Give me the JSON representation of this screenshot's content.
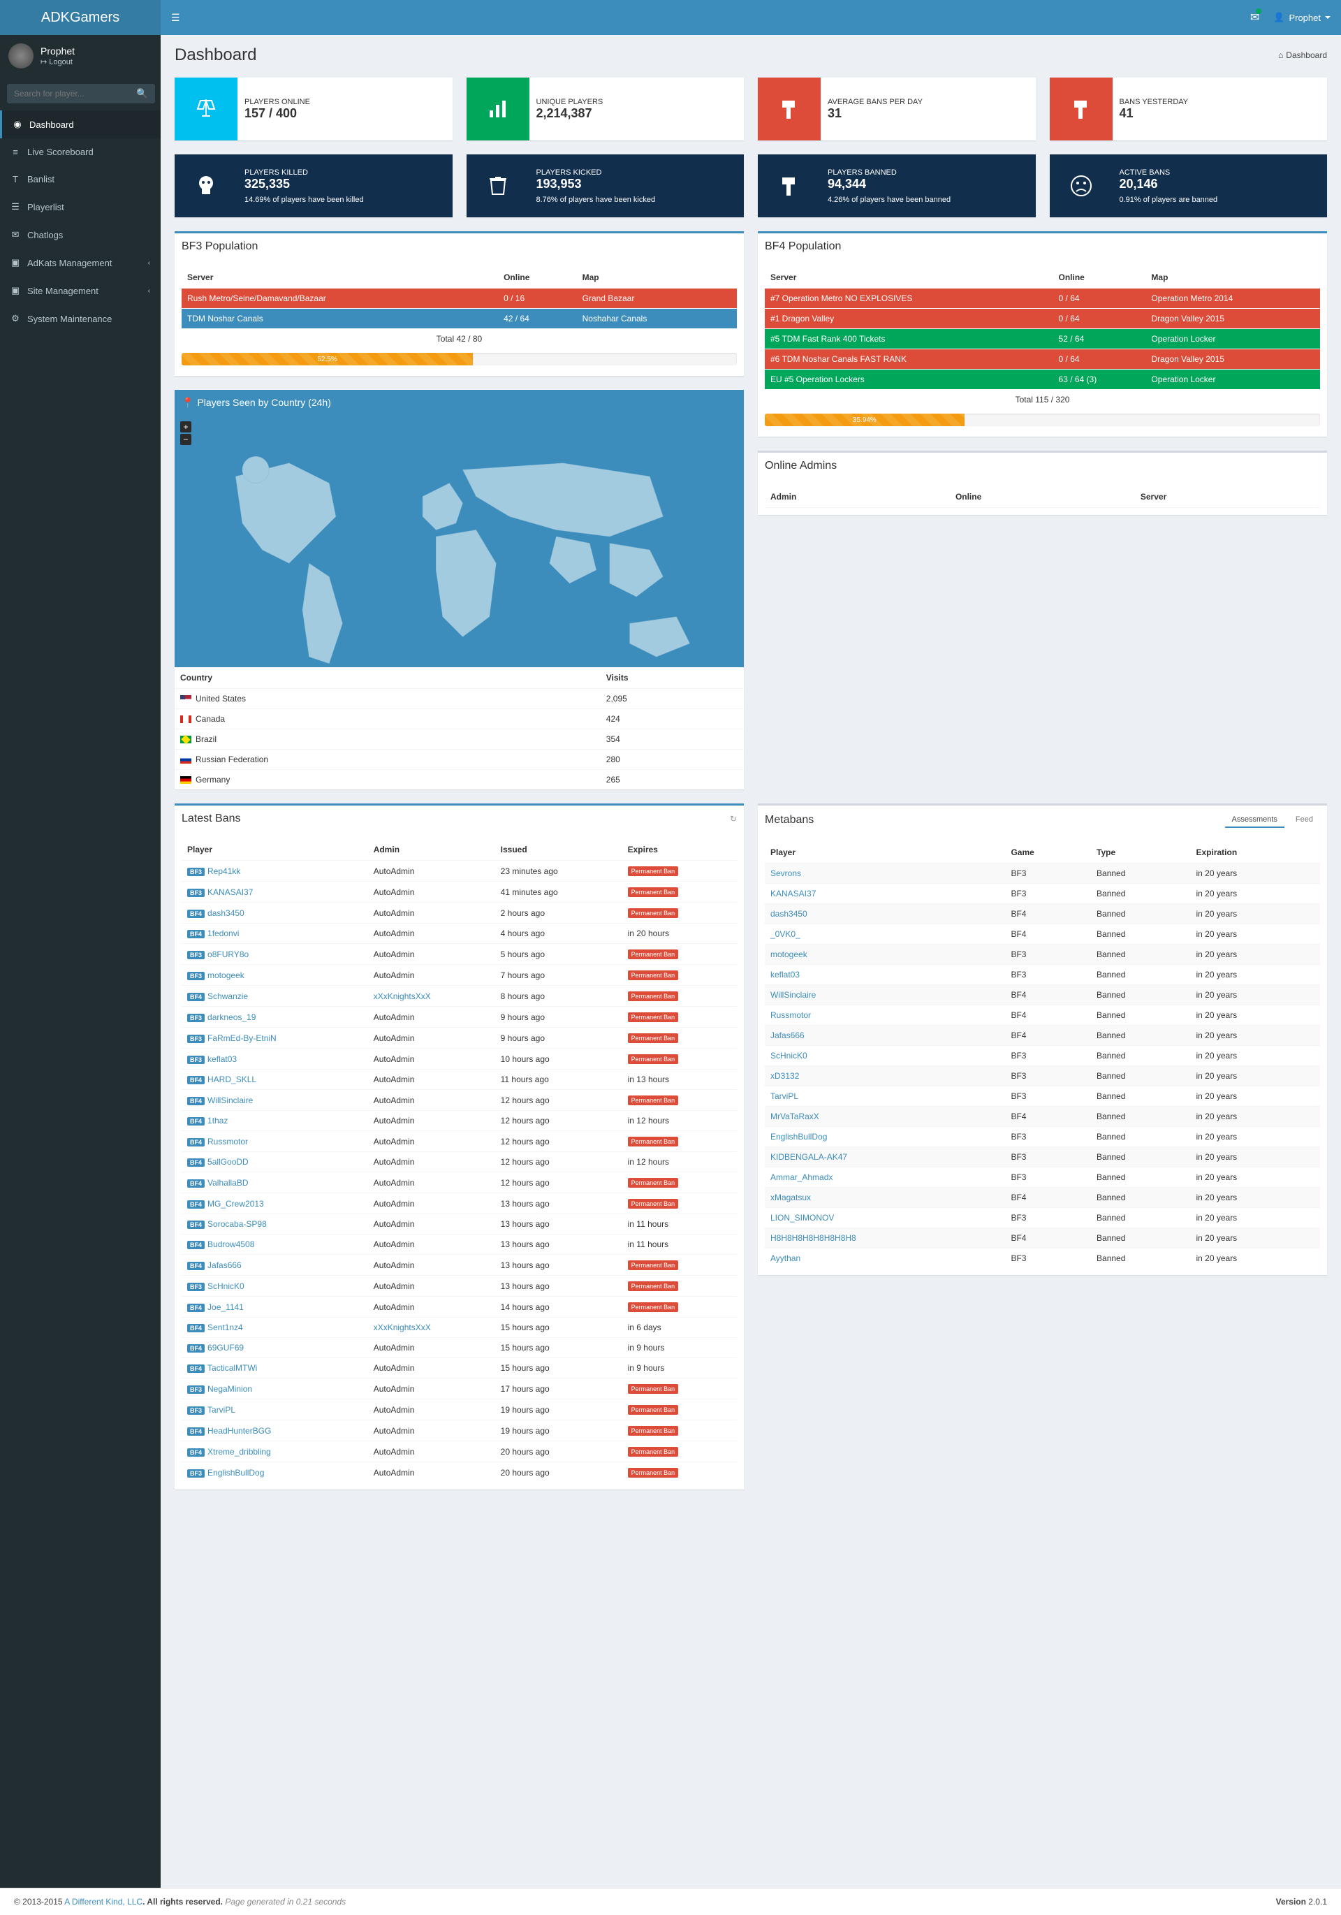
{
  "brand": "ADKGamers",
  "user": {
    "name": "Prophet",
    "logout": "Logout"
  },
  "search_placeholder": "Search for player...",
  "nav_user_label": "Prophet",
  "menu": [
    {
      "icon": "◉",
      "label": "Dashboard",
      "active": true
    },
    {
      "icon": "≡",
      "label": "Live Scoreboard"
    },
    {
      "icon": "T",
      "label": "Banlist"
    },
    {
      "icon": "☰",
      "label": "Playerlist"
    },
    {
      "icon": "✉",
      "label": "Chatlogs"
    },
    {
      "icon": "▣",
      "label": "AdKats Management",
      "chev": true
    },
    {
      "icon": "▣",
      "label": "Site Management",
      "chev": true
    },
    {
      "icon": "⚙",
      "label": "System Maintenance"
    }
  ],
  "page_title": "Dashboard",
  "breadcrumb": "Dashboard",
  "stats_top": [
    {
      "label": "PLAYERS ONLINE",
      "value": "157 / 400",
      "bg": "bg-aqua",
      "icon": "scales"
    },
    {
      "label": "UNIQUE PLAYERS",
      "value": "2,214,387",
      "bg": "bg-green",
      "icon": "chart"
    },
    {
      "label": "AVERAGE BANS PER DAY",
      "value": "31",
      "bg": "bg-red",
      "icon": "hammer"
    },
    {
      "label": "BANS YESTERDAY",
      "value": "41",
      "bg": "bg-red",
      "icon": "hammer"
    }
  ],
  "stats_dark": [
    {
      "label": "PLAYERS KILLED",
      "value": "325,335",
      "footer": "14.69% of players have been killed",
      "icon": "skull"
    },
    {
      "label": "PLAYERS KICKED",
      "value": "193,953",
      "footer": "8.76% of players have been kicked",
      "icon": "trash"
    },
    {
      "label": "PLAYERS BANNED",
      "value": "94,344",
      "footer": "4.26% of players have been banned",
      "icon": "hammer"
    },
    {
      "label": "ACTIVE BANS",
      "value": "20,146",
      "footer": "0.91% of players are banned",
      "icon": "sad"
    }
  ],
  "bf3": {
    "title": "BF3 Population",
    "headers": [
      "Server",
      "Online",
      "Map"
    ],
    "rows": [
      {
        "cls": "srv-red",
        "server": "Rush Metro/Seine/Damavand/Bazaar",
        "online": "0 / 16",
        "map": "Grand Bazaar"
      },
      {
        "cls": "srv-blue",
        "server": "TDM Noshar Canals",
        "online": "42 / 64",
        "map": "Noshahar Canals"
      }
    ],
    "total": "Total   42 / 80",
    "pct": "52.5%",
    "pctw": "52.5%"
  },
  "bf4": {
    "title": "BF4 Population",
    "headers": [
      "Server",
      "Online",
      "Map"
    ],
    "rows": [
      {
        "cls": "srv-red",
        "server": "#7 Operation Metro NO EXPLOSIVES",
        "online": "0 / 64",
        "map": "Operation Metro 2014"
      },
      {
        "cls": "srv-red",
        "server": "#1 Dragon Valley",
        "online": "0 / 64",
        "map": "Dragon Valley 2015"
      },
      {
        "cls": "srv-green",
        "server": "#5 TDM Fast Rank 400 Tickets",
        "online": "52 / 64",
        "map": "Operation Locker"
      },
      {
        "cls": "srv-red",
        "server": "#6 TDM Noshar Canals FAST RANK",
        "online": "0 / 64",
        "map": "Dragon Valley 2015"
      },
      {
        "cls": "srv-green",
        "server": "EU #5 Operation Lockers",
        "online": "63 / 64 (3)",
        "map": "Operation Locker"
      }
    ],
    "total": "Total   115 / 320",
    "pct": "35.94%",
    "pctw": "35.94%"
  },
  "map_title": "Players Seen by Country (24h)",
  "countries": {
    "headers": [
      "Country",
      "Visits"
    ],
    "rows": [
      {
        "flag": "f-us",
        "name": "United States",
        "visits": "2,095"
      },
      {
        "flag": "f-ca",
        "name": "Canada",
        "visits": "424"
      },
      {
        "flag": "f-br",
        "name": "Brazil",
        "visits": "354"
      },
      {
        "flag": "f-ru",
        "name": "Russian Federation",
        "visits": "280"
      },
      {
        "flag": "f-de",
        "name": "Germany",
        "visits": "265"
      }
    ]
  },
  "admins": {
    "title": "Online Admins",
    "headers": [
      "Admin",
      "Online",
      "Server"
    ]
  },
  "latest_bans": {
    "title": "Latest Bans",
    "headers": [
      "Player",
      "Admin",
      "Issued",
      "Expires"
    ],
    "rows": [
      {
        "g": "BF3",
        "p": "Rep41kk",
        "a": "AutoAdmin",
        "i": "23 minutes ago",
        "e": "perm"
      },
      {
        "g": "BF3",
        "p": "KANASAI37",
        "a": "AutoAdmin",
        "i": "41 minutes ago",
        "e": "perm"
      },
      {
        "g": "BF4",
        "p": "dash3450",
        "a": "AutoAdmin",
        "i": "2 hours ago",
        "e": "perm"
      },
      {
        "g": "BF4",
        "p": "1fedonvi",
        "a": "AutoAdmin",
        "i": "4 hours ago",
        "e": "in 20 hours"
      },
      {
        "g": "BF3",
        "p": "o8FURY8o",
        "a": "AutoAdmin",
        "i": "5 hours ago",
        "e": "perm"
      },
      {
        "g": "BF3",
        "p": "motogeek",
        "a": "AutoAdmin",
        "i": "7 hours ago",
        "e": "perm"
      },
      {
        "g": "BF4",
        "p": "Schwanzie",
        "a": "xXxKnightsXxX",
        "alink": true,
        "i": "8 hours ago",
        "e": "perm"
      },
      {
        "g": "BF3",
        "p": "darkneos_19",
        "a": "AutoAdmin",
        "i": "9 hours ago",
        "e": "perm"
      },
      {
        "g": "BF3",
        "p": "FaRmEd-By-EtniN",
        "a": "AutoAdmin",
        "i": "9 hours ago",
        "e": "perm"
      },
      {
        "g": "BF3",
        "p": "keflat03",
        "a": "AutoAdmin",
        "i": "10 hours ago",
        "e": "perm"
      },
      {
        "g": "BF4",
        "p": "HARD_SKLL",
        "a": "AutoAdmin",
        "i": "11 hours ago",
        "e": "in 13 hours"
      },
      {
        "g": "BF4",
        "p": "WillSinclaire",
        "a": "AutoAdmin",
        "i": "12 hours ago",
        "e": "perm"
      },
      {
        "g": "BF4",
        "p": "1thaz",
        "a": "AutoAdmin",
        "i": "12 hours ago",
        "e": "in 12 hours"
      },
      {
        "g": "BF4",
        "p": "Russmotor",
        "a": "AutoAdmin",
        "i": "12 hours ago",
        "e": "perm"
      },
      {
        "g": "BF4",
        "p": "5allGooDD",
        "a": "AutoAdmin",
        "i": "12 hours ago",
        "e": "in 12 hours"
      },
      {
        "g": "BF4",
        "p": "ValhallaBD",
        "a": "AutoAdmin",
        "i": "12 hours ago",
        "e": "perm"
      },
      {
        "g": "BF4",
        "p": "MG_Crew2013",
        "a": "AutoAdmin",
        "i": "13 hours ago",
        "e": "perm"
      },
      {
        "g": "BF4",
        "p": "Sorocaba-SP98",
        "a": "AutoAdmin",
        "i": "13 hours ago",
        "e": "in 11 hours"
      },
      {
        "g": "BF4",
        "p": "Budrow4508",
        "a": "AutoAdmin",
        "i": "13 hours ago",
        "e": "in 11 hours"
      },
      {
        "g": "BF4",
        "p": "Jafas666",
        "a": "AutoAdmin",
        "i": "13 hours ago",
        "e": "perm"
      },
      {
        "g": "BF3",
        "p": "ScHnicK0",
        "a": "AutoAdmin",
        "i": "13 hours ago",
        "e": "perm"
      },
      {
        "g": "BF4",
        "p": "Joe_1141",
        "a": "AutoAdmin",
        "i": "14 hours ago",
        "e": "perm"
      },
      {
        "g": "BF4",
        "p": "Sent1nz4",
        "a": "xXxKnightsXxX",
        "alink": true,
        "i": "15 hours ago",
        "e": "in 6 days"
      },
      {
        "g": "BF4",
        "p": "69GUF69",
        "a": "AutoAdmin",
        "i": "15 hours ago",
        "e": "in 9 hours"
      },
      {
        "g": "BF4",
        "p": "TacticalMTWi",
        "a": "AutoAdmin",
        "i": "15 hours ago",
        "e": "in 9 hours"
      },
      {
        "g": "BF3",
        "p": "NegaMinion",
        "a": "AutoAdmin",
        "i": "17 hours ago",
        "e": "perm"
      },
      {
        "g": "BF3",
        "p": "TarviPL",
        "a": "AutoAdmin",
        "i": "19 hours ago",
        "e": "perm"
      },
      {
        "g": "BF4",
        "p": "HeadHunterBGG",
        "a": "AutoAdmin",
        "i": "19 hours ago",
        "e": "perm"
      },
      {
        "g": "BF4",
        "p": "Xtreme_dribbling",
        "a": "AutoAdmin",
        "i": "20 hours ago",
        "e": "perm"
      },
      {
        "g": "BF3",
        "p": "EnglishBullDog",
        "a": "AutoAdmin",
        "i": "20 hours ago",
        "e": "perm"
      }
    ],
    "perm_label": "Permanent Ban"
  },
  "metabans": {
    "title": "Metabans",
    "tabs": [
      "Assessments",
      "Feed"
    ],
    "headers": [
      "Player",
      "Game",
      "Type",
      "Expiration"
    ],
    "rows": [
      {
        "p": "Sevrons",
        "g": "BF3",
        "t": "Banned",
        "e": "in 20 years"
      },
      {
        "p": "KANASAI37",
        "g": "BF3",
        "t": "Banned",
        "e": "in 20 years"
      },
      {
        "p": "dash3450",
        "g": "BF4",
        "t": "Banned",
        "e": "in 20 years"
      },
      {
        "p": "_0VK0_",
        "g": "BF4",
        "t": "Banned",
        "e": "in 20 years"
      },
      {
        "p": "motogeek",
        "g": "BF3",
        "t": "Banned",
        "e": "in 20 years"
      },
      {
        "p": "keflat03",
        "g": "BF3",
        "t": "Banned",
        "e": "in 20 years"
      },
      {
        "p": "WillSinclaire",
        "g": "BF4",
        "t": "Banned",
        "e": "in 20 years"
      },
      {
        "p": "Russmotor",
        "g": "BF4",
        "t": "Banned",
        "e": "in 20 years"
      },
      {
        "p": "Jafas666",
        "g": "BF4",
        "t": "Banned",
        "e": "in 20 years"
      },
      {
        "p": "ScHnicK0",
        "g": "BF3",
        "t": "Banned",
        "e": "in 20 years"
      },
      {
        "p": "xD3132",
        "g": "BF3",
        "t": "Banned",
        "e": "in 20 years"
      },
      {
        "p": "TarviPL",
        "g": "BF3",
        "t": "Banned",
        "e": "in 20 years"
      },
      {
        "p": "MrVaTaRaxX",
        "g": "BF4",
        "t": "Banned",
        "e": "in 20 years"
      },
      {
        "p": "EnglishBullDog",
        "g": "BF3",
        "t": "Banned",
        "e": "in 20 years"
      },
      {
        "p": "KIDBENGALA-AK47",
        "g": "BF3",
        "t": "Banned",
        "e": "in 20 years"
      },
      {
        "p": "Ammar_Ahmadx",
        "g": "BF3",
        "t": "Banned",
        "e": "in 20 years"
      },
      {
        "p": "xMagatsux",
        "g": "BF4",
        "t": "Banned",
        "e": "in 20 years"
      },
      {
        "p": "LION_SIMONOV",
        "g": "BF3",
        "t": "Banned",
        "e": "in 20 years"
      },
      {
        "p": "H8H8H8H8H8H8H8H8",
        "g": "BF4",
        "t": "Banned",
        "e": "in 20 years"
      },
      {
        "p": "Ayythan",
        "g": "BF3",
        "t": "Banned",
        "e": "in 20 years"
      }
    ]
  },
  "footer": {
    "copyright": "© 2013-2015 ",
    "brand": "A Different Kind, LLC",
    "rights": ". All rights reserved. ",
    "gen": "Page generated in 0.21 seconds",
    "version_label": "Version ",
    "version": "2.0.1"
  }
}
